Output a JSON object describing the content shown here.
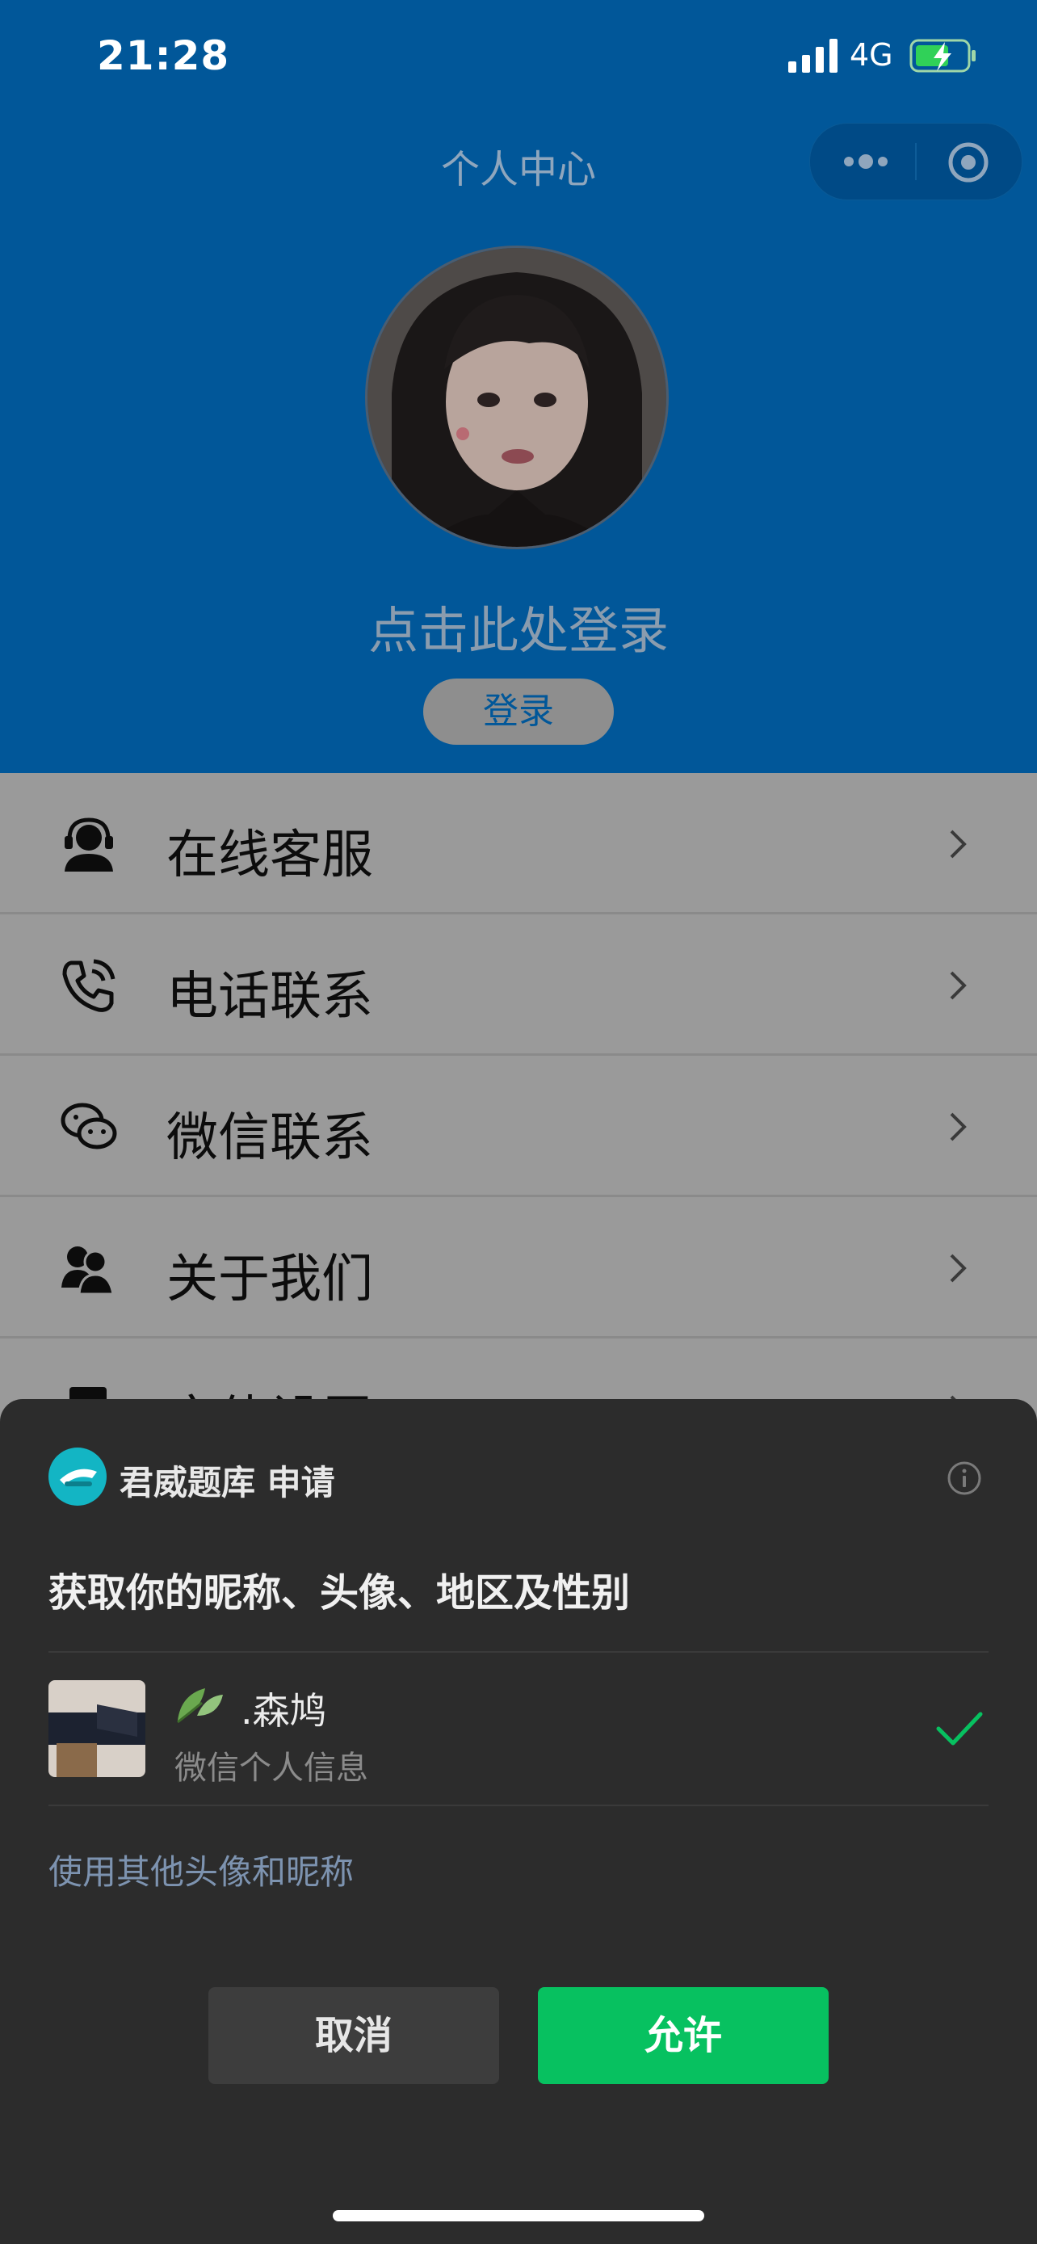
{
  "status_bar": {
    "time": "21:28",
    "network": "4G"
  },
  "nav": {
    "title": "个人中心"
  },
  "profile": {
    "login_hint": "点击此处登录",
    "login_button": "登录"
  },
  "menu": {
    "items": [
      {
        "label": "在线客服",
        "icon": "headset-agent-icon"
      },
      {
        "label": "电话联系",
        "icon": "phone-icon"
      },
      {
        "label": "微信联系",
        "icon": "wechat-icon"
      },
      {
        "label": "关于我们",
        "icon": "users-icon"
      },
      {
        "label": "字体设置",
        "icon": "font-settings-icon"
      }
    ]
  },
  "sheet": {
    "app_name": "君威题库 申请",
    "permission_text": "获取你的昵称、头像、地区及性别",
    "account_name": ".森鸠",
    "account_sub": "微信个人信息",
    "other_link": "使用其他头像和昵称",
    "cancel_label": "取消",
    "allow_label": "允许"
  },
  "colors": {
    "header_bg": "#015799",
    "sheet_bg": "#2c2c2c",
    "allow_green": "#07c160",
    "link_blue": "#7d93b0"
  }
}
